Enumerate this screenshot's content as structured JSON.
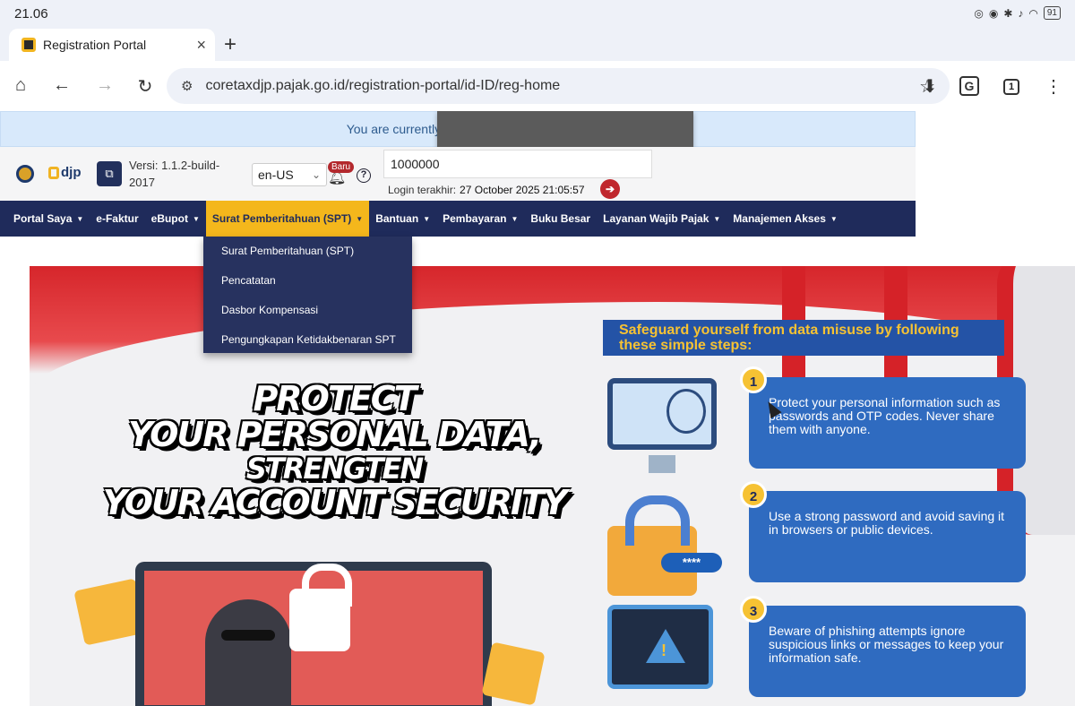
{
  "status_bar": {
    "time": "21.06",
    "icons": [
      "nfc-icon",
      "eye-icon",
      "bluetooth-icon",
      "mute-icon",
      "wifi-icon"
    ],
    "battery": "91"
  },
  "tab": {
    "title": "Registration Portal",
    "close": "×",
    "new_tab": "+"
  },
  "toolbar": {
    "home": "⌂",
    "back": "←",
    "forward": "→",
    "reload": "↻",
    "url": "coretaxdjp.pajak.go.id/registration-portal/id-ID/reg-home",
    "star": "☆",
    "download": "⬇",
    "translate": "G",
    "tab_count": "1",
    "menu": "⋮"
  },
  "banner_notice": {
    "text": "You are currently impersonating user: - !"
  },
  "header": {
    "logo": "djp",
    "version_label": "Versi:",
    "version_value": "1.1.2-build-2017",
    "language": "en-US",
    "badge_new": "Baru",
    "help": "?",
    "npwp_value": "1000000",
    "last_login_label": "Login terakhir:",
    "last_login_value": "27 October 2025 21:05:57"
  },
  "nav": {
    "items": [
      {
        "label": "Portal Saya",
        "dropdown": true
      },
      {
        "label": "e-Faktur",
        "dropdown": false
      },
      {
        "label": "eBupot",
        "dropdown": true
      },
      {
        "label": "Surat Pemberitahuan (SPT)",
        "dropdown": true,
        "active": true
      },
      {
        "label": "Bantuan",
        "dropdown": true
      },
      {
        "label": "Pembayaran",
        "dropdown": true
      },
      {
        "label": "Buku Besar",
        "dropdown": false
      },
      {
        "label": "Layanan Wajib Pajak",
        "dropdown": true
      },
      {
        "label": "Manajemen Akses",
        "dropdown": true
      }
    ],
    "dropdown_caret": "▼",
    "active_accent": "#f4b71c",
    "bar_color": "#1f2b5b"
  },
  "spt_menu": {
    "items": [
      "Surat Pemberitahuan (SPT)",
      "Pencatatan",
      "Dasbor Kompensasi",
      "Pengungkapan Ketidakbenaran SPT"
    ]
  },
  "promo": {
    "headline": [
      "PROTECT",
      "YOUR PERSONAL DATA,",
      "STRENGTEN",
      "YOUR ACCOUNT SECURITY"
    ],
    "steps_title": "Safeguard yourself from data misuse by following these simple steps:",
    "steps": [
      {
        "number": "1",
        "text": "Protect your personal information such as passwords and OTP codes. Never share them with anyone."
      },
      {
        "number": "2",
        "text": "Use a strong password and avoid saving it in browsers or public devices."
      },
      {
        "number": "3",
        "text": "Beware of phishing attempts ignore suspicious links or messages to keep your information safe."
      }
    ],
    "password_mask": "****",
    "warning_mark": "!"
  }
}
